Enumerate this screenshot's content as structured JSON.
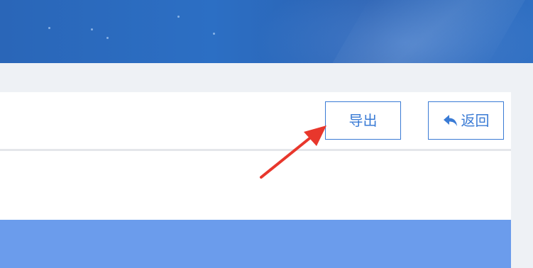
{
  "toolbar": {
    "export_label": "导出",
    "back_label": "返回"
  },
  "icons": {
    "back": "undo-arrow-icon"
  },
  "colors": {
    "banner": "#2c6fc4",
    "accent": "#3a7bd5",
    "table_header": "#6b9cec",
    "annotation_arrow": "#e8372c"
  }
}
